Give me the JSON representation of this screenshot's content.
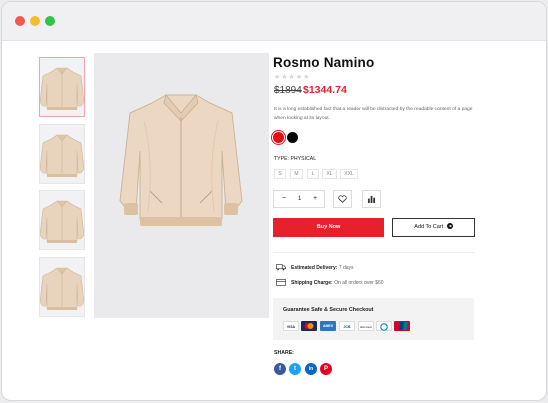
{
  "window": {
    "controls": [
      "close",
      "minimize",
      "maximize"
    ]
  },
  "gallery": {
    "thumbnails": [
      {
        "name": "thumbnail-1",
        "selected": true
      },
      {
        "name": "thumbnail-2",
        "selected": false
      },
      {
        "name": "thumbnail-3",
        "selected": false
      },
      {
        "name": "thumbnail-4",
        "selected": false
      }
    ]
  },
  "product": {
    "title": "Rosmo Namino",
    "rating": 0,
    "rating_max": 5,
    "stars": "★★★★★",
    "old_price": "$1894",
    "new_price": "$1344.74",
    "description": "It is a long established fact that a reader will be distracted by the readable content of a page when looking at its layout.",
    "colors": [
      "#e50f12",
      "#050505"
    ],
    "type_label": "TYPE:",
    "type_value": "PHYSICAL",
    "sizes": [
      "S",
      "M",
      "L",
      "XL",
      "XXL"
    ],
    "quantity": {
      "minus": "−",
      "value": "1",
      "plus": "+"
    },
    "buy_now": "Buy Now",
    "add_to_cart": "Add To Cart"
  },
  "shipping": {
    "delivery_label": "Estimated Delivery:",
    "delivery_value": "7 days",
    "charge_label": "Shipping Charge:",
    "charge_value": "On all orders over $60"
  },
  "checkout": {
    "title": "Guarantee Safe & Secure Checkout",
    "cards": [
      "VISA",
      "mastercard",
      "AMEX",
      "JCB",
      "discover",
      "diners",
      "UnionPay"
    ]
  },
  "share": {
    "label": "SHARE:",
    "networks": [
      {
        "name": "facebook",
        "glyph": "f",
        "color": "#3b5998"
      },
      {
        "name": "twitter",
        "glyph": "t",
        "color": "#1da1f2"
      },
      {
        "name": "linkedin",
        "glyph": "in",
        "color": "#0a66c2"
      },
      {
        "name": "pinterest",
        "glyph": "P",
        "color": "#e60023"
      }
    ]
  },
  "colors": {
    "accent": "#e8202c",
    "price": "#e4202c"
  }
}
